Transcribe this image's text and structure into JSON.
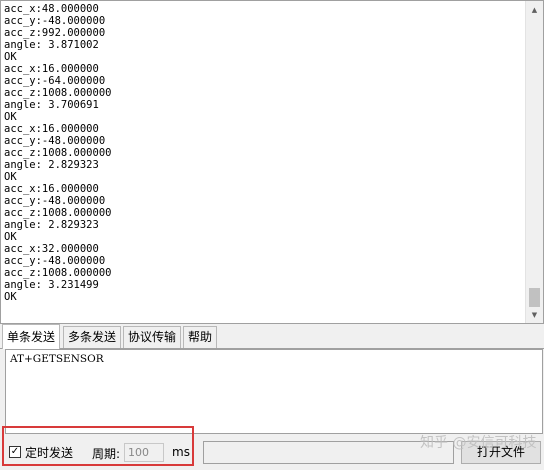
{
  "output": {
    "lines": [
      "acc_x:48.000000",
      "acc_y:-48.000000",
      "acc_z:992.000000",
      "angle: 3.871002",
      "OK",
      "acc_x:16.000000",
      "acc_y:-64.000000",
      "acc_z:1008.000000",
      "angle: 3.700691",
      "OK",
      "acc_x:16.000000",
      "acc_y:-48.000000",
      "acc_z:1008.000000",
      "angle: 2.829323",
      "OK",
      "acc_x:16.000000",
      "acc_y:-48.000000",
      "acc_z:1008.000000",
      "angle: 2.829323",
      "OK",
      "acc_x:32.000000",
      "acc_y:-48.000000",
      "acc_z:1008.000000",
      "angle: 3.231499",
      "OK"
    ]
  },
  "scrollbar": {
    "up_icon": "arrow-up-icon",
    "down_icon": "arrow-down-icon"
  },
  "tabs": [
    {
      "label": "单条发送",
      "active": true
    },
    {
      "label": "多条发送",
      "active": false
    },
    {
      "label": "协议传输",
      "active": false
    },
    {
      "label": "帮助",
      "active": false
    }
  ],
  "input": {
    "value": "AT+GETSENSOR"
  },
  "bottom": {
    "timer_label": "定时发送",
    "timer_checked": true,
    "period_label": "周期:",
    "period_value": "100",
    "unit_label": "ms",
    "open_file_label": "打开文件"
  },
  "watermark": "知乎 @安信可科技",
  "colors": {
    "highlight": "#d83a3a"
  }
}
